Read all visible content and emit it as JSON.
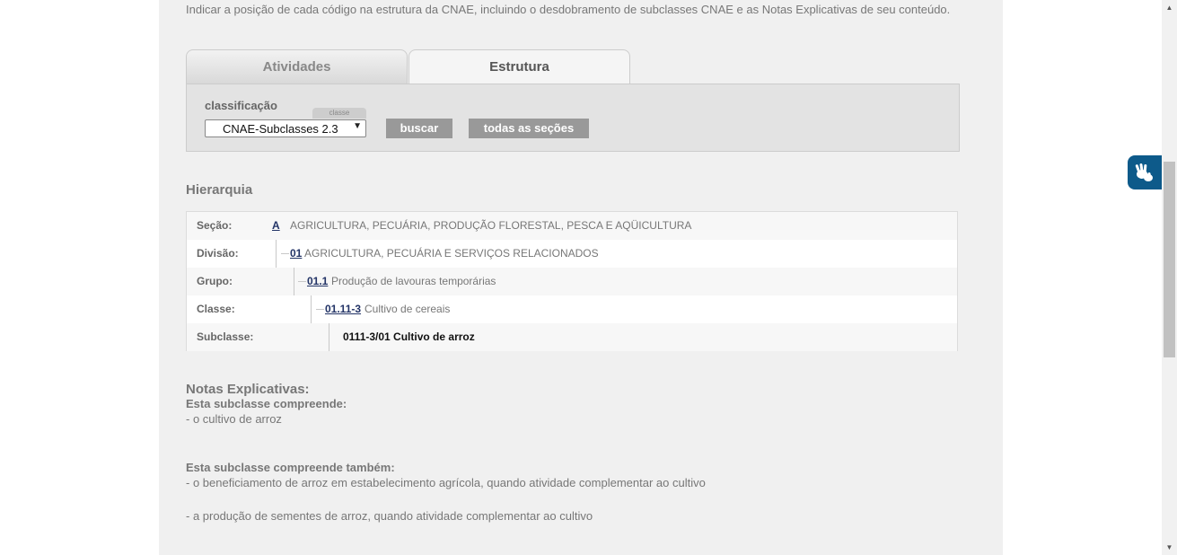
{
  "intro": "Indicar a posição de cada código na estrutura da CNAE, incluindo o desdobramento de subclasses CNAE e as Notas Explicativas de seu conteúdo.",
  "tabs": [
    {
      "label": "Atividades",
      "active": false
    },
    {
      "label": "Estrutura",
      "active": true
    }
  ],
  "search": {
    "label": "classificação",
    "mini_tab": "classe",
    "select_value": "CNAE-Subclasses 2.3",
    "buscar": "buscar",
    "todas": "todas as seções"
  },
  "hierarchy": {
    "title": "Hierarquia",
    "rows": [
      {
        "label": "Seção:",
        "code": "A",
        "text": "AGRICULTURA, PECUÁRIA, PRODUÇÃO FLORESTAL, PESCA E AQÜICULTURA"
      },
      {
        "label": "Divisão:",
        "code": "01",
        "text": "AGRICULTURA, PECUÁRIA E SERVIÇOS RELACIONADOS"
      },
      {
        "label": "Grupo:",
        "code": "01.1",
        "text": "Produção de lavouras temporárias"
      },
      {
        "label": "Classe:",
        "code": "01.11-3",
        "text": "Cultivo de cereais"
      },
      {
        "label": "Subclasse:",
        "current": "0111-3/01 Cultivo de arroz"
      }
    ]
  },
  "notes": {
    "title": "Notas Explicativas:",
    "h1": "Esta subclasse compreende:",
    "t1": "- o cultivo de arroz",
    "h2": "Esta subclasse compreende também:",
    "t2": "- o beneficiamento de arroz em estabelecimento agrícola, quando atividade complementar ao cultivo",
    "t3": "- a produção de sementes de arroz, quando atividade complementar ao cultivo"
  },
  "colors": {
    "panel_bg": "#f0f0f0",
    "button_bg": "#999999",
    "link": "#223366",
    "accessibility_button": "#0d5a8a"
  },
  "icons": {
    "accessibility": "hand-sign-language-icon",
    "select": "chevron-down-icon"
  }
}
